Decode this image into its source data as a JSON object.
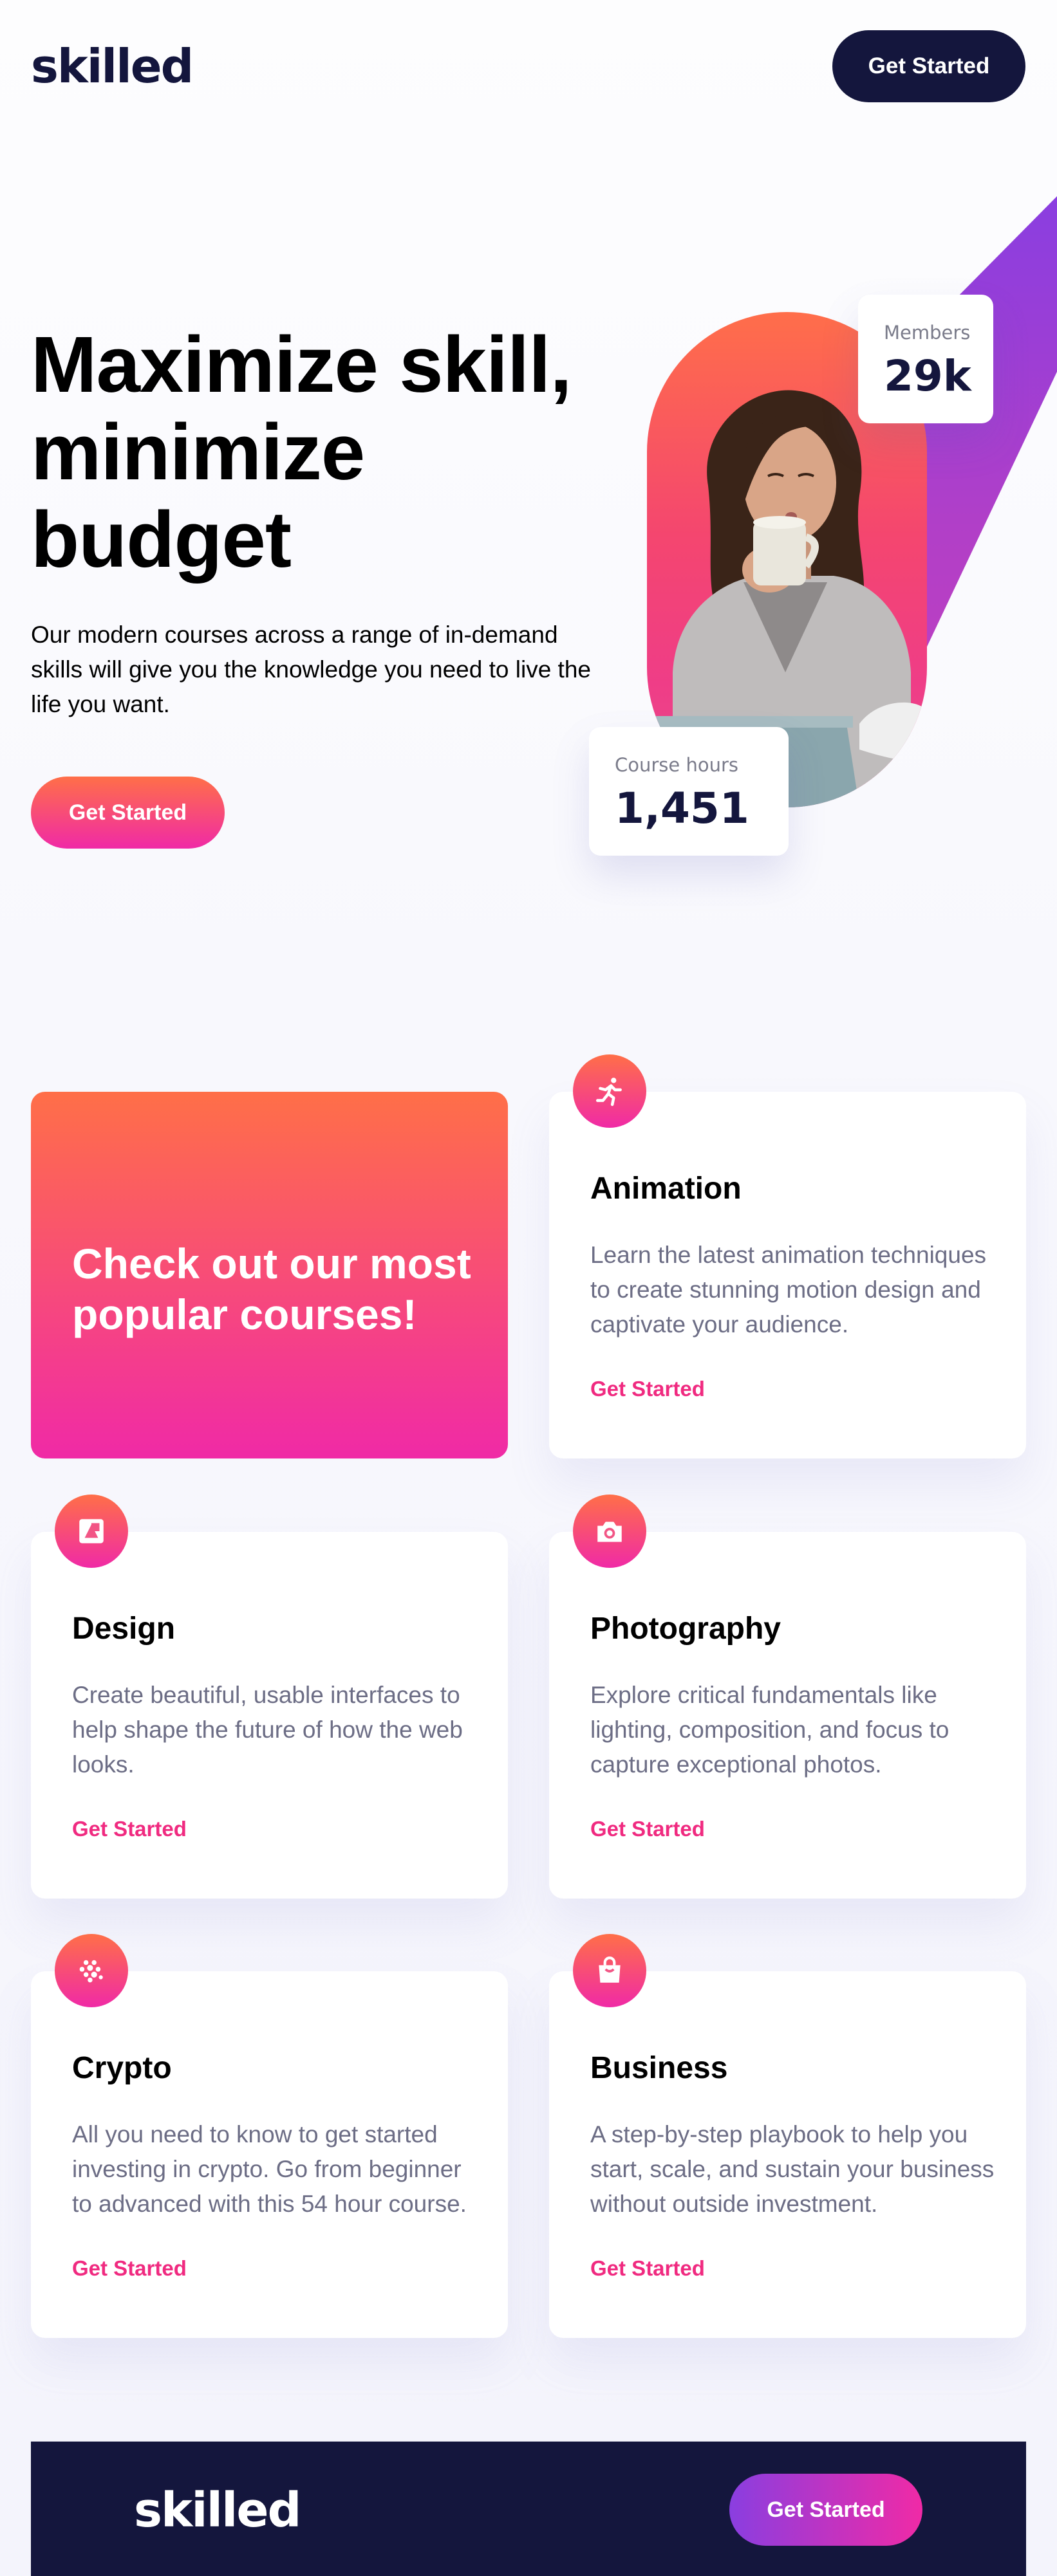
{
  "header": {
    "logo": "skilled",
    "cta_label": "Get Started"
  },
  "hero": {
    "title": "Maximize skill, minimize budget",
    "description": "Our modern courses across a range of in-demand skills will give you the knowledge you need to live the life you want.",
    "cta_label": "Get Started",
    "stats": {
      "members": {
        "label": "Members",
        "value": "29k"
      },
      "course_hours": {
        "label": "Course hours",
        "value": "1,451"
      }
    }
  },
  "courses": {
    "promo_text": "Check out our most popular courses!",
    "items": [
      {
        "title": "Animation",
        "icon": "running-person-icon",
        "description": "Learn the latest animation techniques to create stunning motion design and captivate your audience.",
        "link_label": "Get Started"
      },
      {
        "title": "Design",
        "icon": "design-frame-icon",
        "description": "Create beautiful, usable interfaces to help shape the future of how the web looks.",
        "link_label": "Get Started"
      },
      {
        "title": "Photography",
        "icon": "camera-icon",
        "description": "Explore critical fundamentals like lighting, composition, and focus to capture exceptional photos.",
        "link_label": "Get Started"
      },
      {
        "title": "Crypto",
        "icon": "crypto-dots-icon",
        "description": "All you need to know to get started investing in crypto. Go from beginner to advanced with this 54 hour course.",
        "link_label": "Get Started"
      },
      {
        "title": "Business",
        "icon": "shopping-bag-icon",
        "description": "A step-by-step playbook to help you start, scale, and sustain your business without outside investment.",
        "link_label": "Get Started"
      }
    ]
  },
  "footer": {
    "logo": "skilled",
    "cta_label": "Get Started"
  },
  "colors": {
    "navy": "#14163d",
    "gradient_start": "#ff6f48",
    "gradient_end": "#f02aa6",
    "purple": "#8a3ee0",
    "link_pink": "#f02a80",
    "text_muted": "#6c6d85"
  }
}
